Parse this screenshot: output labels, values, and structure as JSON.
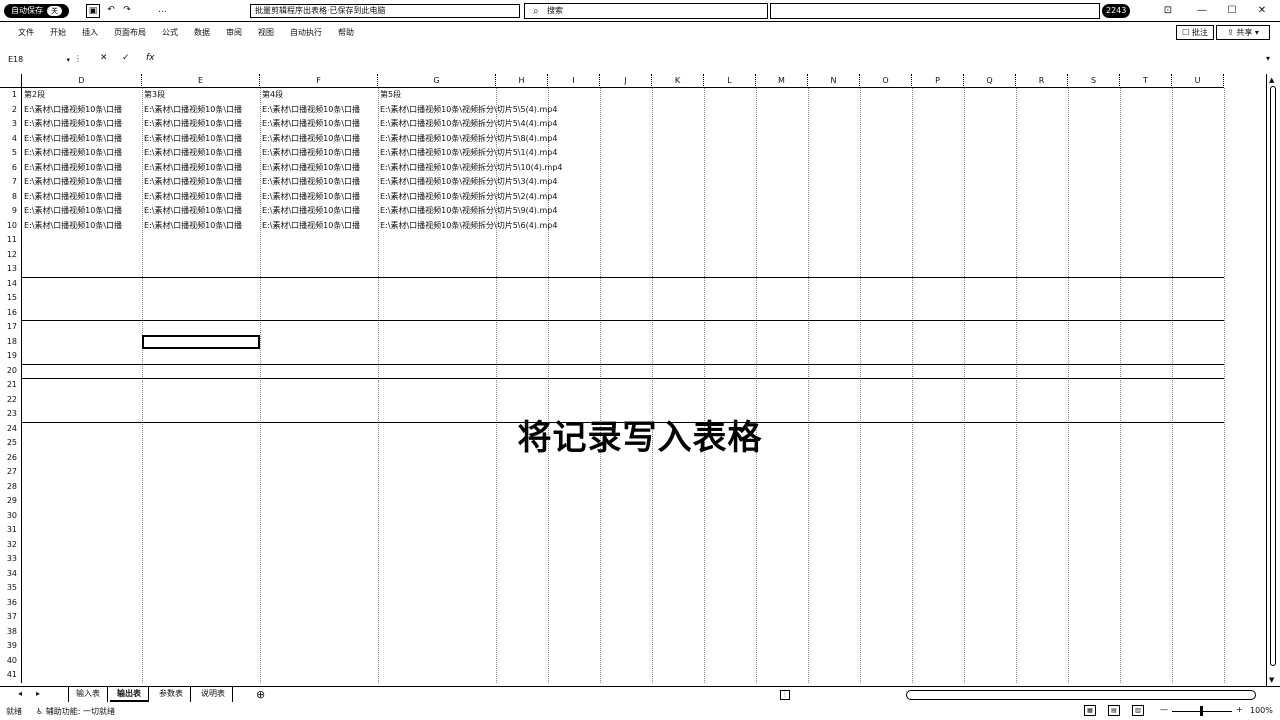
{
  "titlebar": {
    "autosave_label": "自动保存",
    "autosave_state": "关",
    "undo_label": "...",
    "doc_title": "批量剪辑程序出表格·已保存到此电脑",
    "search_placeholder": "搜索",
    "user_badge": "2243",
    "window_controls": [
      "⊡",
      "—",
      "☐",
      "✕"
    ]
  },
  "menu": {
    "items": [
      "文件",
      "开始",
      "插入",
      "页面布局",
      "公式",
      "数据",
      "审阅",
      "视图",
      "自动执行",
      "帮助"
    ],
    "comment_label": "批注",
    "share_label": "共享"
  },
  "formula_bar": {
    "name_box": "E18",
    "fx": "fx",
    "value": ""
  },
  "grid": {
    "columns": [
      "D",
      "E",
      "F",
      "G",
      "H",
      "I",
      "J",
      "K",
      "L",
      "M",
      "N",
      "O",
      "P",
      "Q",
      "R",
      "S",
      "T",
      "U"
    ],
    "rows": [
      "1",
      "2",
      "3",
      "4",
      "5",
      "6",
      "7",
      "8",
      "9",
      "10",
      "11",
      "12",
      "13",
      "14",
      "15",
      "16",
      "17",
      "18",
      "19",
      "20",
      "21",
      "22",
      "23",
      "24",
      "25",
      "26",
      "27",
      "28",
      "29",
      "30",
      "31",
      "32",
      "33",
      "34",
      "35",
      "36",
      "37",
      "38",
      "39",
      "40",
      "41"
    ],
    "header_row": [
      "第2段",
      "第3段",
      "第4段",
      "第5段"
    ],
    "data_rows": [
      [
        "E:\\素材\\口播视频10条\\口播",
        "E:\\素材\\口播视频10条\\口播",
        "E:\\素材\\口播视频10条\\口播",
        "E:\\素材\\口播视频10条\\视频拆分\\切片5\\5(4).mp4"
      ],
      [
        "E:\\素材\\口播视频10条\\口播",
        "E:\\素材\\口播视频10条\\口播",
        "E:\\素材\\口播视频10条\\口播",
        "E:\\素材\\口播视频10条\\视频拆分\\切片5\\4(4).mp4"
      ],
      [
        "E:\\素材\\口播视频10条\\口播",
        "E:\\素材\\口播视频10条\\口播",
        "E:\\素材\\口播视频10条\\口播",
        "E:\\素材\\口播视频10条\\视频拆分\\切片5\\8(4).mp4"
      ],
      [
        "E:\\素材\\口播视频10条\\口播",
        "E:\\素材\\口播视频10条\\口播",
        "E:\\素材\\口播视频10条\\口播",
        "E:\\素材\\口播视频10条\\视频拆分\\切片5\\1(4).mp4"
      ],
      [
        "E:\\素材\\口播视频10条\\口播",
        "E:\\素材\\口播视频10条\\口播",
        "E:\\素材\\口播视频10条\\口播",
        "E:\\素材\\口播视频10条\\视频拆分\\切片5\\10(4).mp4"
      ],
      [
        "E:\\素材\\口播视频10条\\口播",
        "E:\\素材\\口播视频10条\\口播",
        "E:\\素材\\口播视频10条\\口播",
        "E:\\素材\\口播视频10条\\视频拆分\\切片5\\3(4).mp4"
      ],
      [
        "E:\\素材\\口播视频10条\\口播",
        "E:\\素材\\口播视频10条\\口播",
        "E:\\素材\\口播视频10条\\口播",
        "E:\\素材\\口播视频10条\\视频拆分\\切片5\\2(4).mp4"
      ],
      [
        "E:\\素材\\口播视频10条\\口播",
        "E:\\素材\\口播视频10条\\口播",
        "E:\\素材\\口播视频10条\\口播",
        "E:\\素材\\口播视频10条\\视频拆分\\切片5\\9(4).mp4"
      ],
      [
        "E:\\素材\\口播视频10条\\口播",
        "E:\\素材\\口播视频10条\\口播",
        "E:\\素材\\口播视频10条\\口播",
        "E:\\素材\\口播视频10条\\视频拆分\\切片5\\6(4).mp4"
      ]
    ]
  },
  "overlay_caption": "将记录写入表格",
  "sheets": {
    "tabs": [
      "输入表",
      "输出表",
      "参数表",
      "说明表"
    ],
    "active_index": 1
  },
  "status": {
    "mode": "就绪",
    "accessibility": "辅助功能: 一切就绪",
    "zoom": "100%"
  }
}
